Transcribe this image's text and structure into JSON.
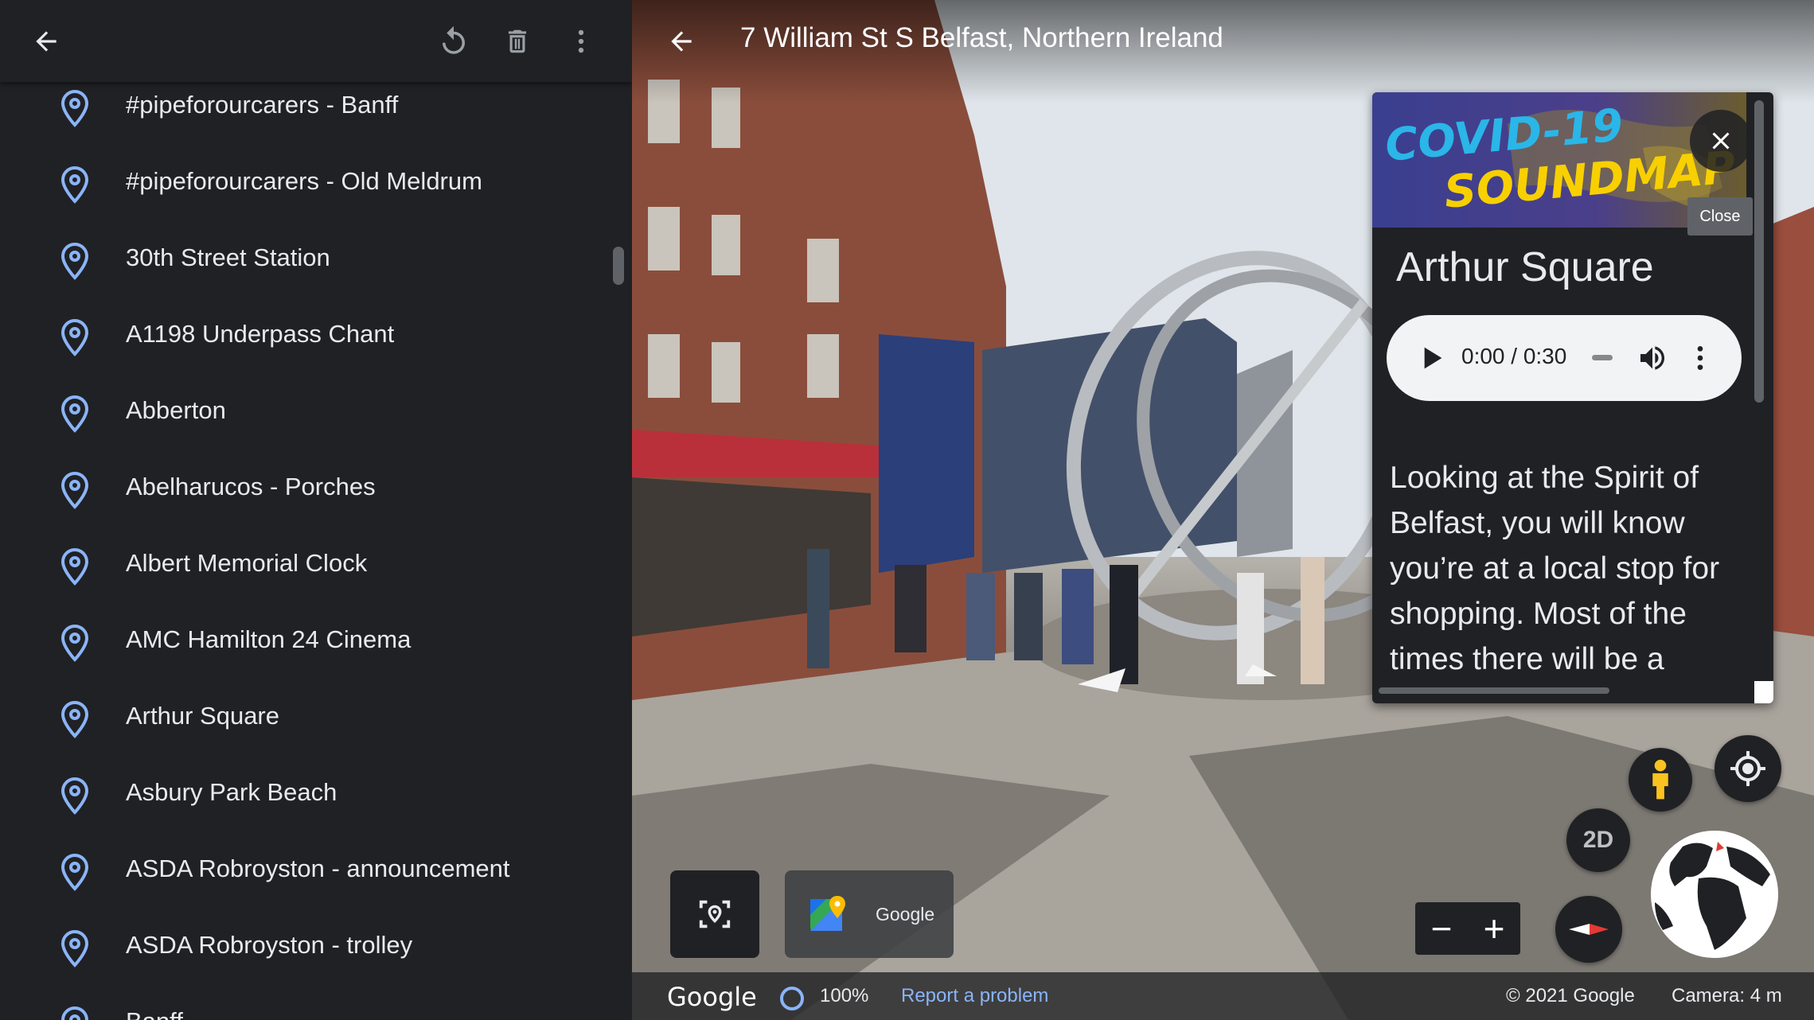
{
  "sidebar": {
    "header": {
      "back_icon": "arrow-back-icon",
      "refresh_icon": "refresh-icon",
      "delete_icon": "trash-icon",
      "more_icon": "more-vert-icon"
    },
    "items": [
      {
        "label": "#pipeforourcarers - Banff"
      },
      {
        "label": "#pipeforourcarers - Old Meldrum"
      },
      {
        "label": "30th Street Station"
      },
      {
        "label": "A1198 Underpass Chant"
      },
      {
        "label": "Abberton"
      },
      {
        "label": "Abelharucos - Porches"
      },
      {
        "label": "Albert Memorial Clock"
      },
      {
        "label": "AMC Hamilton 24 Cinema"
      },
      {
        "label": "Arthur Square"
      },
      {
        "label": "Asbury Park Beach"
      },
      {
        "label": "ASDA Robroyston - announcement"
      },
      {
        "label": "ASDA Robroyston - trolley"
      },
      {
        "label": "Banff"
      }
    ],
    "pin_color": "#8ab4f8"
  },
  "viewer": {
    "address": "7 William St S Belfast, Northern Ireland",
    "card": {
      "banner_line1": "COVID-19",
      "banner_line2": "SOUNDMAP",
      "close_tooltip": "Close",
      "title": "Arthur Square",
      "audio_time": "0:00 / 0:30",
      "description": "Looking at the Spirit of Belfast, you will know you’re at a local stop for shopping. Most of the times there will be a"
    },
    "controls": {
      "view_mode": "2D",
      "zoom_out": "−",
      "zoom_in": "+",
      "gmaps_label": "Google"
    },
    "bottom_bar": {
      "logo": "Google",
      "zoom": "100%",
      "report": "Report a problem",
      "copyright": "© 2021 Google",
      "camera": "Camera: 4 m"
    }
  },
  "colors": {
    "panel_bg": "#202124",
    "text": "#e8eaed",
    "accent": "#8ab4f8"
  }
}
